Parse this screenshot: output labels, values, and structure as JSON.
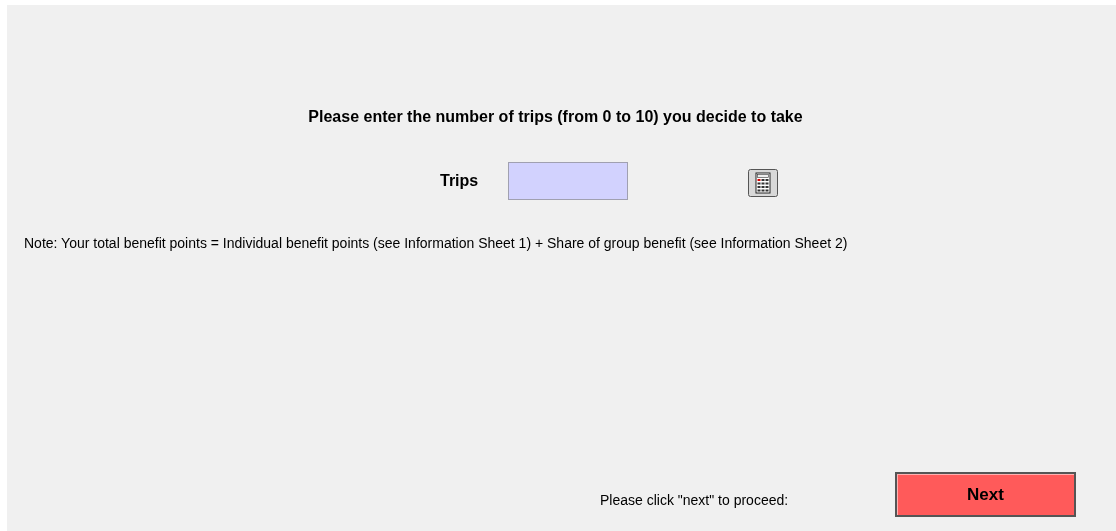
{
  "instruction": "Please enter the number of trips (from 0 to 10) you decide to take",
  "trips_field": {
    "label": "Trips"
  },
  "note": "Note: Your total benefit points = Individual benefit points (see Information Sheet 1)  + Share of group benefit (see Information Sheet 2)",
  "footer": {
    "prompt": "Please click \"next\" to proceed:",
    "button": "Next"
  }
}
